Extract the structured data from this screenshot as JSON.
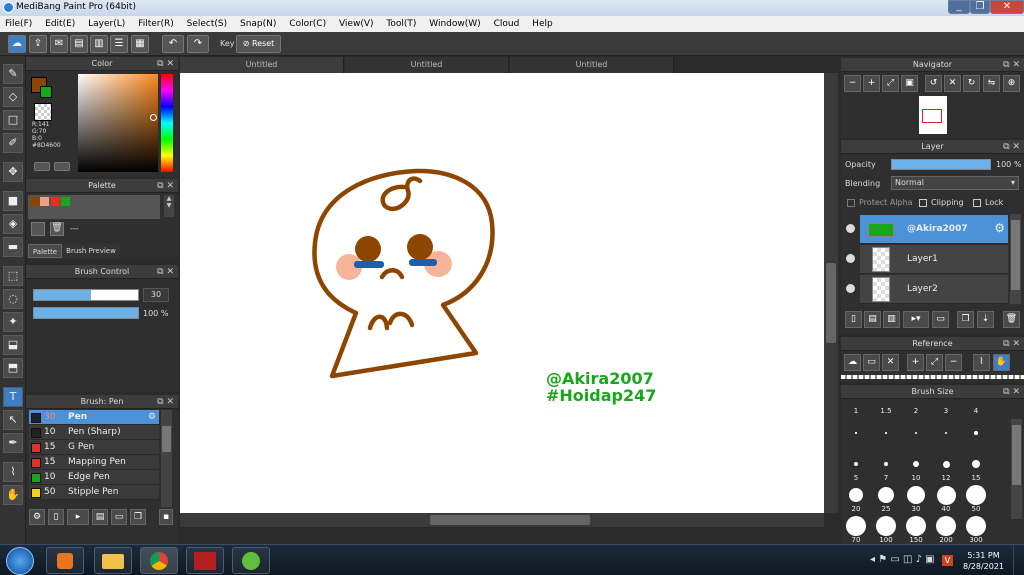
{
  "window": {
    "title": "MediBang Paint Pro (64bit)",
    "minimize": "_",
    "maximize": "❐",
    "close": "✕"
  },
  "menu": [
    "File(F)",
    "Edit(E)",
    "Layer(L)",
    "Filter(R)",
    "Select(S)",
    "Snap(N)",
    "Color(C)",
    "View(V)",
    "Tool(T)",
    "Window(W)",
    "Cloud",
    "Help"
  ],
  "toolbar": {
    "key_label": "Key",
    "reset_label": "Reset"
  },
  "color_panel": {
    "title": "Color",
    "r": "R:141",
    "g": "G:70",
    "b": "B:0",
    "hex": "#8D4600",
    "main_color": "#8D4600",
    "sub_color": "#ffffff",
    "accent": "#1aa61a"
  },
  "palette_panel": {
    "title": "Palette",
    "swatches": [
      "#8D4600",
      "#f0a080",
      "#e03020",
      "#1aa61a"
    ],
    "name": "---",
    "tab_palette": "Palette",
    "tab_brush_preview": "Brush Preview"
  },
  "brush_control": {
    "title": "Brush Control",
    "size": "30",
    "opacity": "100 %",
    "size_fill": 0.55,
    "opacity_fill": 1.0
  },
  "brush_panel": {
    "title": "Brush: Pen",
    "items": [
      {
        "size": "30",
        "name": "Pen",
        "color": "#222222",
        "selected": true
      },
      {
        "size": "10",
        "name": "Pen (Sharp)",
        "color": "#222222"
      },
      {
        "size": "15",
        "name": "G Pen",
        "color": "#e03030"
      },
      {
        "size": "15",
        "name": "Mapping Pen",
        "color": "#e03030"
      },
      {
        "size": "10",
        "name": "Edge Pen",
        "color": "#1aa61a"
      },
      {
        "size": "50",
        "name": "Stipple Pen",
        "color": "#f0d020"
      }
    ]
  },
  "tabs": [
    "Untitled",
    "Untitled",
    "Untitled"
  ],
  "canvas": {
    "watermark1": "@Akira2007",
    "watermark2": "#Hoidap247",
    "watermark_color": "#1aa61a",
    "drawing_color": "#8D4600"
  },
  "navigator": {
    "title": "Navigator"
  },
  "layer_panel": {
    "title": "Layer",
    "opacity_label": "Opacity",
    "opacity_value": "100 %",
    "opacity_fill": 1.0,
    "blending_label": "Blending",
    "blending_value": "Normal",
    "protect_alpha": "Protect Alpha",
    "clipping": "Clipping",
    "lock": "Lock",
    "layers": [
      {
        "name": "@Akira2007",
        "selected": true
      },
      {
        "name": "Layer1"
      },
      {
        "name": "Layer2"
      }
    ]
  },
  "reference_panel": {
    "title": "Reference"
  },
  "brush_size_panel": {
    "title": "Brush Size",
    "sizes": [
      "1",
      "1.5",
      "2",
      "3",
      "4",
      "5",
      "7",
      "10",
      "12",
      "15",
      "20",
      "25",
      "30",
      "40",
      "50",
      "70",
      "100",
      "150",
      "200",
      "300"
    ]
  },
  "taskbar": {
    "time": "5:31 PM",
    "date": "8/28/2021"
  }
}
